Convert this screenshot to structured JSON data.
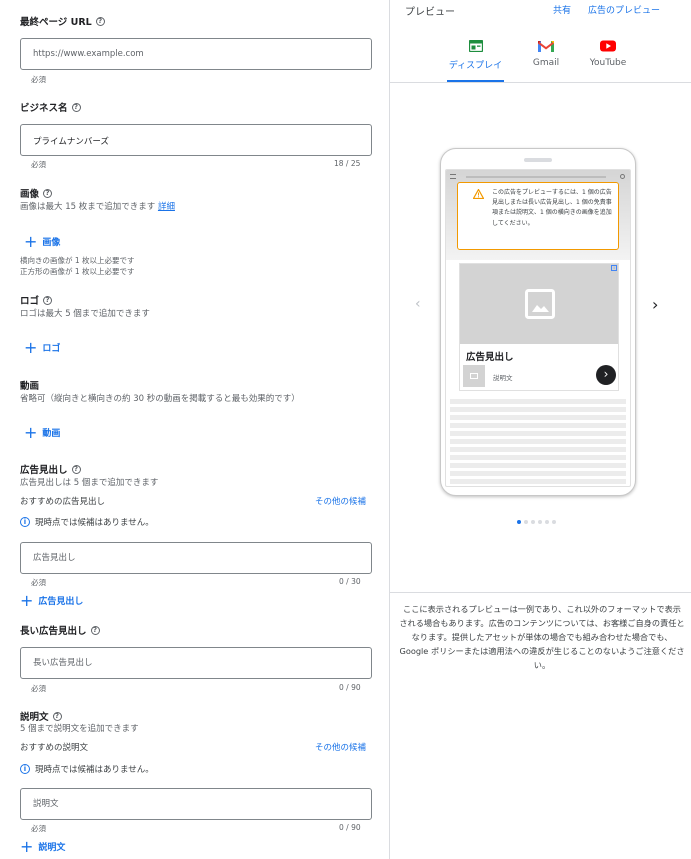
{
  "form": {
    "final_url": {
      "label": "最終ページ URL",
      "placeholder": "https://www.example.com",
      "required": "必須"
    },
    "business_name": {
      "label": "ビジネス名",
      "value": "プライムナンバーズ",
      "required": "必須",
      "counter": "18 / 25"
    },
    "images": {
      "label": "画像",
      "desc": "画像は最大 15 枚まで追加できます",
      "detail_link": "詳細",
      "add_label": "画像",
      "note1": "横向きの画像が 1 枚以上必要です",
      "note2": "正方形の画像が 1 枚以上必要です"
    },
    "logo": {
      "label": "ロゴ",
      "desc": "ロゴは最大 5 個まで追加できます",
      "add_label": "ロゴ"
    },
    "video": {
      "label": "動画",
      "desc": "省略可（縦向きと横向きの約 30 秒の動画を掲載すると最も効果的です）",
      "add_label": "動画"
    },
    "headline": {
      "label": "広告見出し",
      "desc": "広告見出しは 5 個まで追加できます",
      "recommend_label": "おすすめの広告見出し",
      "other_link": "その他の候補",
      "info": "現時点では候補はありません。",
      "placeholder": "広告見出し",
      "required": "必須",
      "counter": "0 / 30",
      "add_label": "広告見出し"
    },
    "long_headline": {
      "label": "長い広告見出し",
      "placeholder": "長い広告見出し",
      "required": "必須",
      "counter": "0 / 90"
    },
    "description": {
      "label": "説明文",
      "desc": "5 個まで説明文を追加できます",
      "recommend_label": "おすすめの説明文",
      "other_link": "その他の候補",
      "info": "現時点では候補はありません。",
      "placeholder": "説明文",
      "required": "必須",
      "counter": "0 / 90",
      "add_label": "説明文"
    }
  },
  "preview": {
    "title": "プレビュー",
    "share": "共有",
    "ad_preview": "広告のプレビュー",
    "tabs": [
      {
        "label": "ディスプレイ",
        "icon": "display-icon",
        "active": true
      },
      {
        "label": "Gmail",
        "icon": "gmail-icon",
        "active": false
      },
      {
        "label": "YouTube",
        "icon": "youtube-icon",
        "active": false
      }
    ],
    "warning": "この広告をプレビューするには、1 個の広告見出しまたは長い広告見出し、1 個の免責事項または説明文、1 個の横向きの画像を追加してください。",
    "ad_headline": "広告見出し",
    "ad_description": "説明文",
    "disclaimer": "ここに表示されるプレビューは一例であり、これ以外のフォーマットで表示される場合もあります。広告のコンテンツについては、お客様ご自身の責任となります。提供したアセットが単体の場合でも組み合わせた場合でも、Google ポリシーまたは適用法への違反が生じることのないようご注意ください。",
    "colors": {
      "accent": "#1a73e8",
      "warning": "#f29900",
      "gmail_red": "#ea4335",
      "youtube_red": "#ff0000",
      "display_green": "#1e8e3e"
    }
  }
}
